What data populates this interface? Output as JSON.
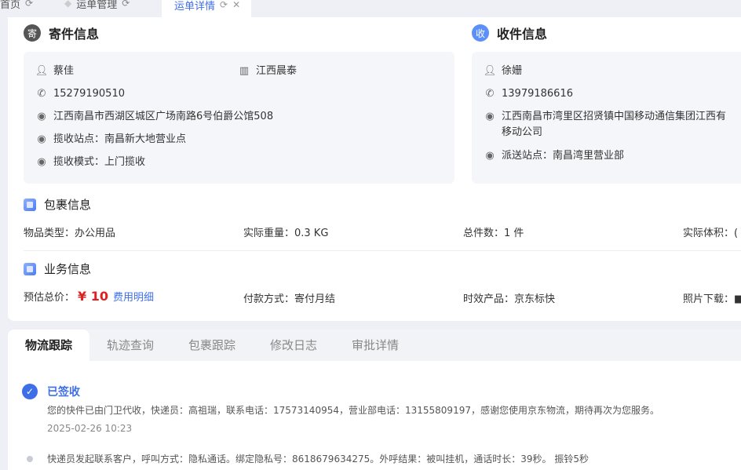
{
  "tabs": [
    {
      "label": "首页"
    },
    {
      "label": "运单管理"
    },
    {
      "label": "运单详情"
    }
  ],
  "sender": {
    "title": "寄件信息",
    "badge": "寄",
    "name": "蔡佳",
    "company": "江西晨泰",
    "phone": "15279190510",
    "address": "江西南昌市西湖区城区广场南路6号伯爵公馆508",
    "station": "揽收站点：南昌新大地营业点",
    "mode": "揽收模式：上门揽收"
  },
  "receiver": {
    "title": "收件信息",
    "badge": "收",
    "name": "徐姗",
    "phone": "13979186616",
    "address_line1": "江西南昌市湾里区招贤镇中国移动通信集团江西有",
    "address_line2": "移动公司",
    "station": "派送站点：南昌湾里营业部"
  },
  "package": {
    "title": "包裹信息",
    "type": "物品类型：办公用品",
    "weight": "实际重量：0.3 KG",
    "count": "总件数：1 件",
    "volume": "实际体积：("
  },
  "business": {
    "title": "业务信息",
    "price_label": "预估总价：",
    "price": "¥ 10",
    "fee_link": "费用明细",
    "payment": "付款方式：寄付月结",
    "product": "时效产品：京东标快",
    "photo": "照片下载：■"
  },
  "bottom_tabs": [
    "物流跟踪",
    "轨迹查询",
    "包裹跟踪",
    "修改日志",
    "审批详情"
  ],
  "timeline": [
    {
      "status": "已签收",
      "text": "您的快件已由门卫代收，快递员：高祖瑞，联系电话：17573140954，营业部电话：13155809197，感谢您使用京东物流，期待再次为您服务。",
      "time": "2025-02-26 10:23"
    },
    {
      "text": "快递员发起联系客户，呼叫方式：隐私通话。绑定隐私号：8618679634275。外呼结果：被叫挂机，通话时长：39秒。 振铃5秒"
    }
  ],
  "colors": {
    "accent": "#3f6fe8",
    "price": "#e02020"
  }
}
